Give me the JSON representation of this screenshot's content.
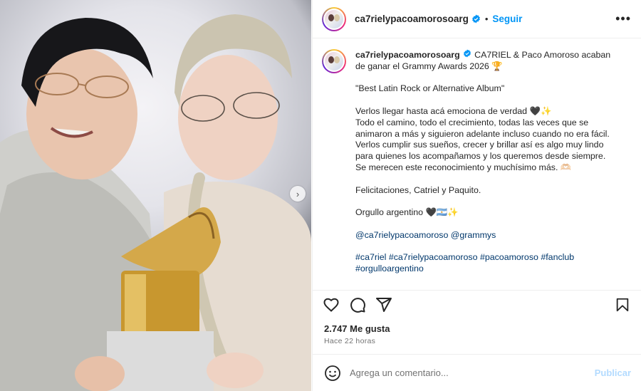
{
  "post": {
    "username": "ca7rielypacoamorosoarg",
    "follow_label": "Seguir",
    "more_label": "•••",
    "dot": "•"
  },
  "caption": {
    "username": "ca7rielypacoamorosoarg",
    "line1": " CA7RIEL & Paco Amoroso acaban de ganar el Grammy Awards 2026 🏆",
    "line2": "\"Best Latin Rock or Alternative Album\"",
    "line3": "Verlos llegar hasta acá emociona de verdad 🖤✨",
    "line4": "Todo el camino, todo el crecimiento, todas las veces que se animaron a más y siguieron adelante incluso cuando no era fácil. Verlos cumplir sus sueños, crecer y brillar así es algo muy lindo para quienes los acompañamos y los queremos desde siempre. Se merecen este reconocimiento y muchísimo más. 🫶🏻",
    "line5": "Felicitaciones, Catriel y Paquito.",
    "line6": "Orgullo argentino 🖤🇦🇷✨",
    "mentions": "@ca7rielypacoamoroso @grammys",
    "hashtags_line1": "#ca7riel #ca7rielypacoamoroso #pacoamoroso #fanclub",
    "hashtags_line2": "#orgulloargentino"
  },
  "stats": {
    "likes": "2.747 Me gusta",
    "time": "Hace 22 horas"
  },
  "comment": {
    "placeholder": "Agrega un comentario...",
    "publish_label": "Publicar"
  },
  "media": {
    "next_arrow": "›"
  },
  "colors": {
    "accent": "#0095f6",
    "link": "#00376b",
    "publish_disabled": "#b3dbff",
    "verified": "#0095f6"
  },
  "icons": [
    "heart-icon",
    "comment-icon",
    "share-icon",
    "bookmark-icon",
    "emoji-icon",
    "verified-icon",
    "chevron-right-icon"
  ]
}
